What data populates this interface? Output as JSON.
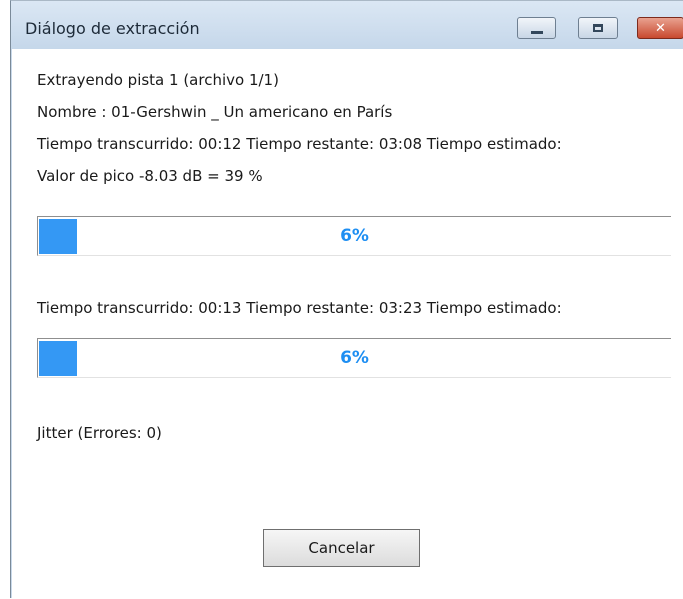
{
  "window": {
    "title": "Diálogo de extracción",
    "minimize_icon": "minimize-icon",
    "maximize_icon": "maximize-icon",
    "close_icon": "close-icon",
    "close_glyph": "✕"
  },
  "track": {
    "extracting": "Extrayendo pista 1 (archivo 1/1)",
    "name": "Nombre : 01-Gershwin _ Un americano en París",
    "times": "Tiempo transcurrido: 00:12 Tiempo restante: 03:08 Tiempo estimado:",
    "peak": "Valor de pico -8.03 dB =  39 %"
  },
  "progress_track": {
    "value": 0.06,
    "label": "6%",
    "fill_color": "#3498f4"
  },
  "total": {
    "times": "Tiempo transcurrido: 00:13 Tiempo restante: 03:23 Tiempo estimado:"
  },
  "progress_total": {
    "value": 0.06,
    "label": "6%",
    "fill_color": "#3498f4"
  },
  "jitter": "Jitter (Errores: 0)",
  "buttons": {
    "cancel": "Cancelar"
  }
}
